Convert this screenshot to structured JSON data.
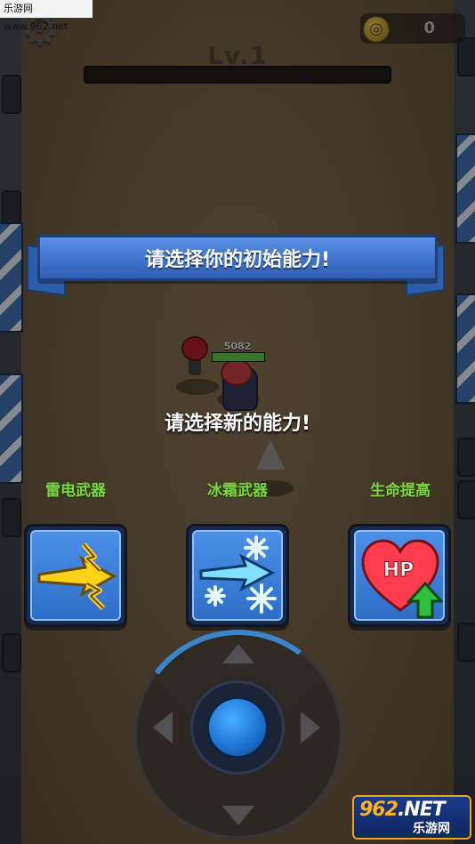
{
  "watermark": {
    "top_left": "乐游网 www.962.net"
  },
  "hud": {
    "coins": "0",
    "level": "Lv.1",
    "xp_fraction": 0.0
  },
  "banner": {
    "title": "请选择你的初始能力!"
  },
  "player": {
    "hp_value": "5082"
  },
  "prompt": "请选择新的能力!",
  "abilities": [
    {
      "label": "雷电武器",
      "icon": "lightning-arrow-icon"
    },
    {
      "label": "冰霜武器",
      "icon": "frost-arrow-icon"
    },
    {
      "label": "生命提高",
      "icon": "hp-heart-up-icon",
      "icon_text": "HP"
    }
  ],
  "logo": {
    "main_prefix": "962",
    "main_suffix": ".NET",
    "sub": "乐游网"
  },
  "colors": {
    "accent_blue": "#3d73cc",
    "ability_label_green": "#7bd642",
    "card_blue": "#2e6ec8"
  }
}
